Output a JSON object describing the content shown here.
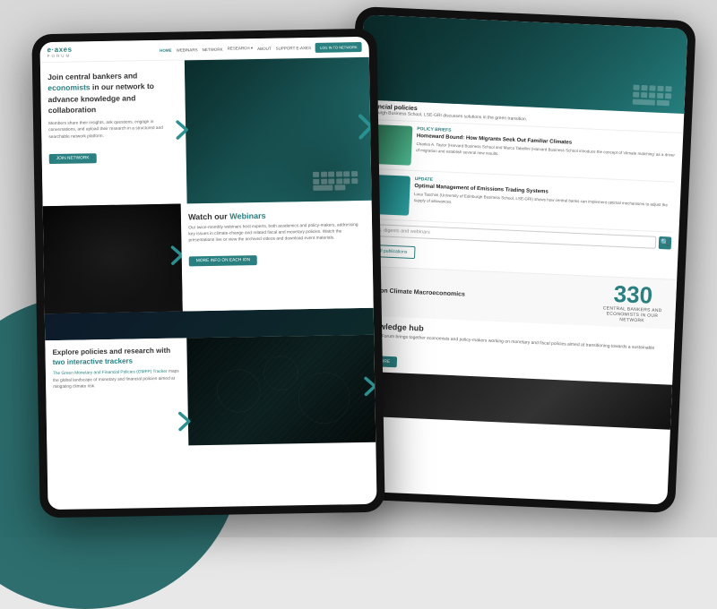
{
  "background": {
    "color": "#e0e0e0"
  },
  "back_tablet": {
    "financial_policies": "financial policies",
    "financial_desc": "Edinburgh Business School, LSE-GRI discusses solutions in the green transition.",
    "article1": {
      "tag": "POLICY BRIEFS",
      "title": "Homeward Bound: How Migrants Seek Out Familiar Climates",
      "author": "Charles A. Taylor (Harvard Business School and Marco Tabellini (Harvard Business School introduce the concept of 'climate matching' as a driver of migration and establish several new results."
    },
    "article2": {
      "tag": "UPDATE",
      "title": "Optimal Management of Emissions Trading Systems",
      "author": "Luca Taschini (University of Edinburgh Business School, LSE-GRI) shows how central banks can implement optimal mechanisms to adjust the supply of allowances."
    },
    "search_placeholder": "papers, digests and webinars",
    "see_all_btn": "See all publications",
    "forum_section": "Forum on Climate Macroeconomics",
    "stat_number": "330",
    "stat_label": "CENTRAL BANKERS AND ECONOMISTS IN OUR NETWORK",
    "knowledge_title": "A knowledge hub",
    "knowledge_desc": "The E-Axes Forum brings together economists and policy-makers working on monetary and fiscal policies aimed at transitioning towards a sustainable economy.",
    "read_more_btn": "READ MORE"
  },
  "front_tablet": {
    "logo_main": "e·axes",
    "logo_sub": "FORUM",
    "nav": {
      "home": "HOME",
      "webinars": "WEBINARS",
      "network": "NETWORK",
      "research": "RESEARCH ▾",
      "about": "ABOUT",
      "support": "SUPPORT E-AXES",
      "login": "LOG IN TO NETWORK"
    },
    "hero": {
      "title_plain": "Join central bankers and",
      "title_highlight": "economists",
      "title_rest": "in our network to advance knowledge and collaboration",
      "description": "Members share their insights, ask questions, engage in conversations, and upload their research in a structured and searchable network platform.",
      "join_btn": "JOIN NETWORK"
    },
    "webinar": {
      "title_plain": "Watch our",
      "title_highlight": "Webinars",
      "description": "Our twice-monthly webinars host experts, both academics and policy-makers, addressing key issues in climate-change and related fiscal and monetary policies. Watch the presentations live or view the archived videos and download event materials.",
      "btn": "MORE INFO ON EACH ION"
    },
    "policies": {
      "title_plain": "Explore policies and research with",
      "title_highlight": "two interactive trackers",
      "description_highlight": "The Green Monetary and Financial Policies (GMFP) Tracker",
      "description_rest": "maps the global landscape of monetary and financial policies aimed at mitigating climate risk."
    }
  }
}
